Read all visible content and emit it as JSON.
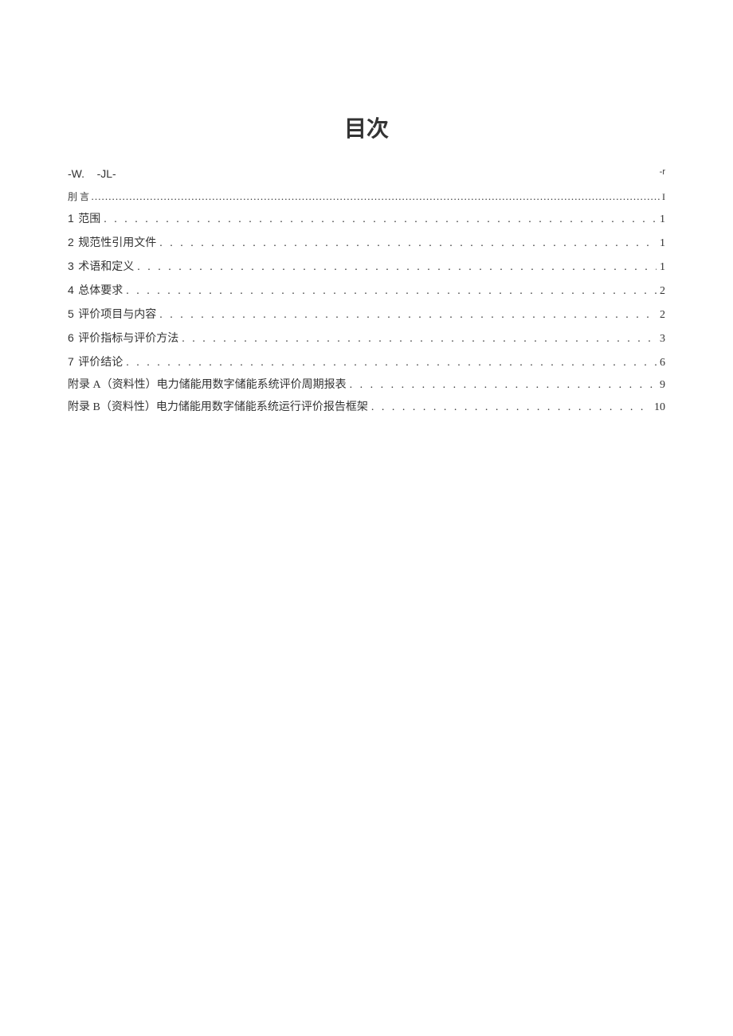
{
  "title": "目次",
  "header": {
    "left1": "-W.",
    "left2": "-JL-",
    "right": "-r"
  },
  "entries": [
    {
      "num": "刖",
      "label": "   言",
      "page": "I",
      "style": "small_tight"
    },
    {
      "num": "1",
      "label": " 范围",
      "page": "1",
      "style": "normal"
    },
    {
      "num": "2",
      "label": " 规范性引用文件",
      "page": "1",
      "style": "normal"
    },
    {
      "num": "3",
      "label": " 术语和定义",
      "page": "1",
      "style": "normal"
    },
    {
      "num": "4",
      "label": " 总体要求",
      "page": "2",
      "style": "normal"
    },
    {
      "num": "5",
      "label": " 评价项目与内容",
      "page": "2",
      "style": "normal"
    },
    {
      "num": "6",
      "label": " 评价指标与评价方法",
      "page": "3",
      "style": "normal"
    },
    {
      "num": "7",
      "label": " 评价结论",
      "page": "6",
      "style": "normal"
    },
    {
      "num": "",
      "label": "附录 A（资料性）电力储能用数字储能系统评价周期报表 ",
      "page": "9",
      "style": "appendix"
    },
    {
      "num": "",
      "label": "附录 B（资料性）电力储能用数字储能系统运行评价报告框架 ",
      "page": "10",
      "style": "appendix"
    }
  ]
}
